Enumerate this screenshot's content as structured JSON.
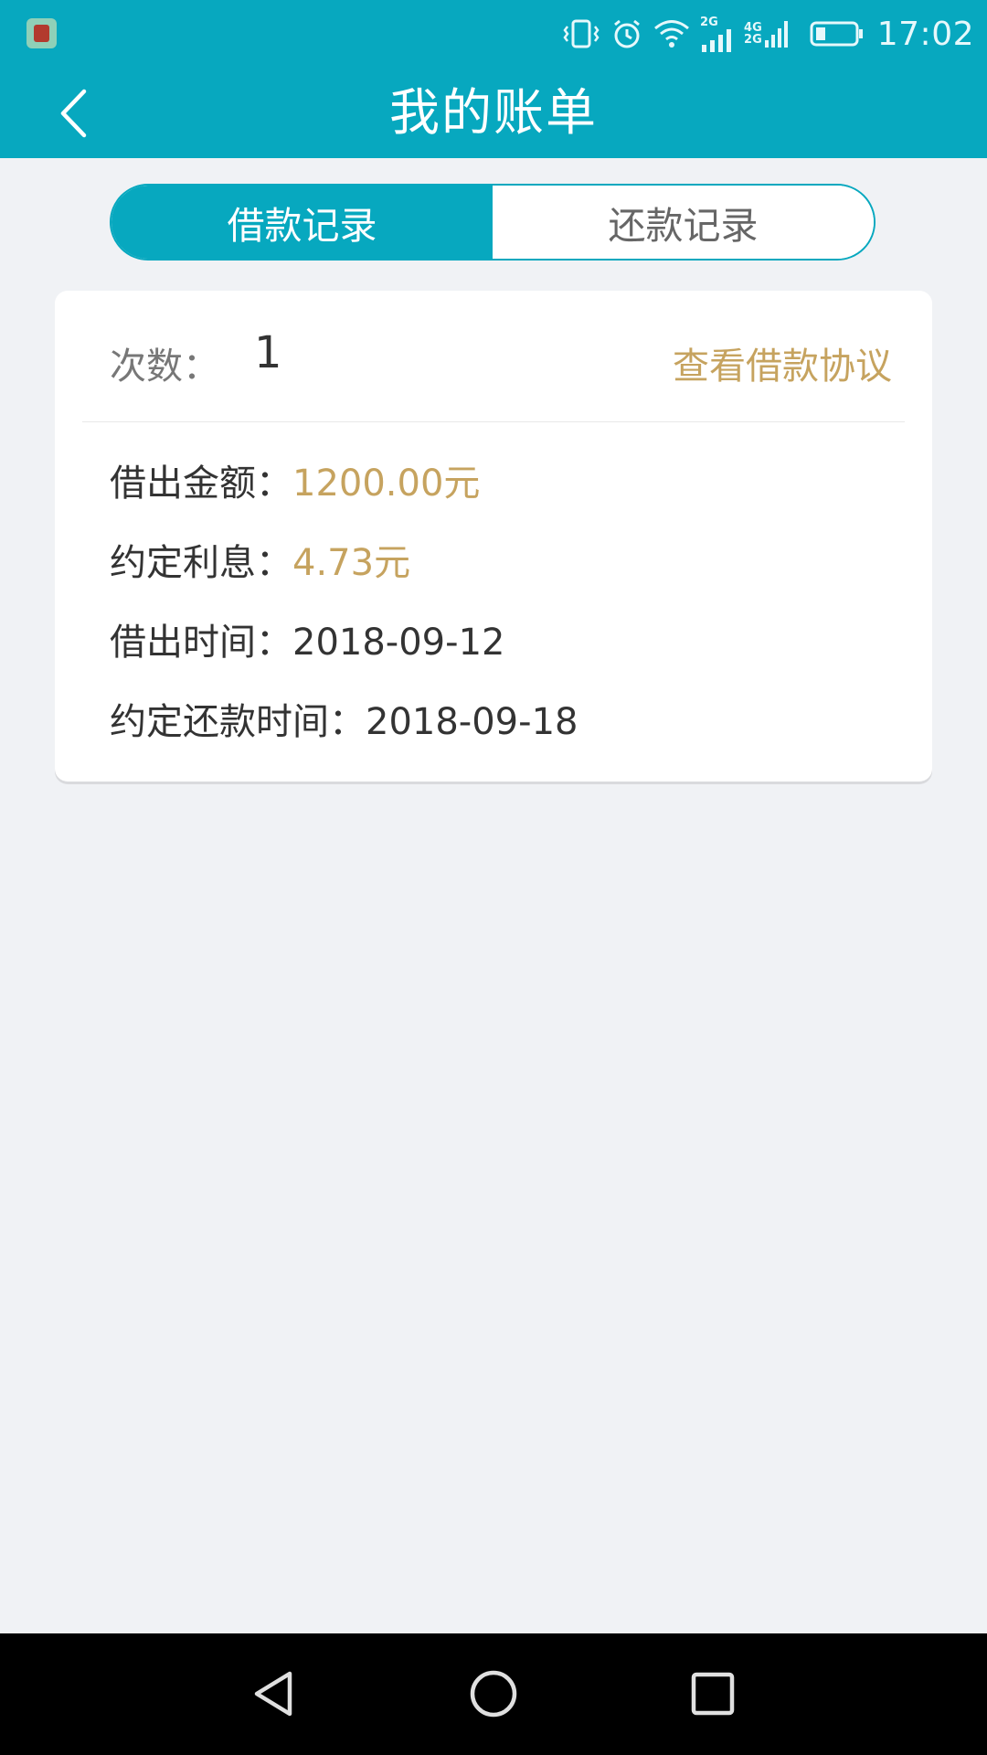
{
  "status_bar": {
    "time": "17:02",
    "network_1": "2G",
    "network_2a": "4G",
    "network_2b": "2G",
    "icons": [
      "app-notification-icon",
      "vibrate-icon",
      "alarm-icon",
      "wifi-icon",
      "signal-icon",
      "battery-icon"
    ]
  },
  "header": {
    "title": "我的账单",
    "back_icon": "chevron-left-icon"
  },
  "tabs": [
    {
      "label": "借款记录",
      "active": true
    },
    {
      "label": "还款记录",
      "active": false
    }
  ],
  "record": {
    "count_label": "次数：",
    "count_value": "1",
    "agreement_link": "查看借款协议",
    "amount_label": "借出金额：",
    "amount_value": "1200.00元",
    "interest_label": "约定利息：",
    "interest_value": "4.73元",
    "loan_date_label": "借出时间：",
    "loan_date_value": "2018-09-12",
    "due_date_label": "约定还款时间：",
    "due_date_value": "2018-09-18"
  },
  "nav_bar": {
    "icons": [
      "back-triangle-icon",
      "home-circle-icon",
      "recents-square-icon"
    ]
  },
  "colors": {
    "primary": "#07a8bf",
    "accent_gold": "#c6a35f",
    "background": "#f0f2f5"
  }
}
